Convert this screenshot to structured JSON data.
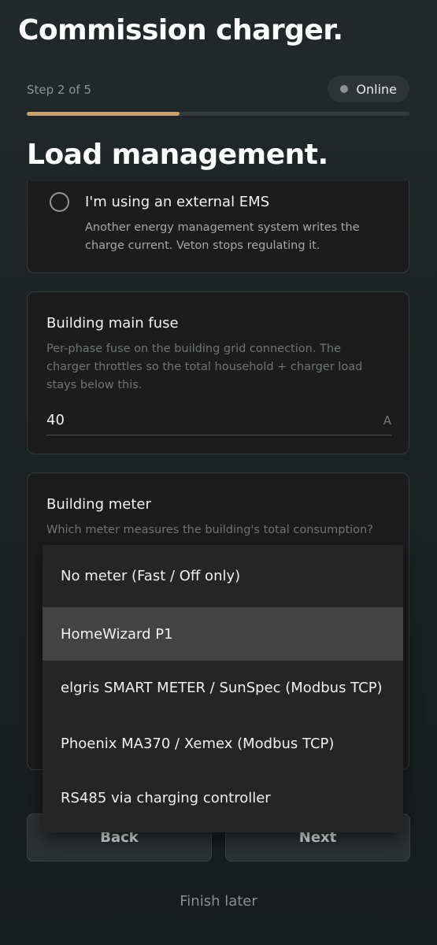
{
  "app": {
    "title": "Commission charger."
  },
  "progress": {
    "step_label": "Step 2 of 5",
    "current_step": 2,
    "total_steps": 5
  },
  "status": {
    "label": "Online",
    "dot_color": "#8c9192"
  },
  "section": {
    "title": "Load management."
  },
  "ems_option": {
    "title": "I'm using an external EMS",
    "description": "Another energy management system writes the charge current. Veton stops regulating it.",
    "checked": false
  },
  "fuse": {
    "label": "Building main fuse",
    "help": "Per-phase fuse on the building grid connection. The charger throttles so the total household + charger load stays below this.",
    "value": "40",
    "unit": "A"
  },
  "meter": {
    "label": "Building meter",
    "help": "Which meter measures the building's total consumption?",
    "selected": "HomeWizard P1",
    "options": [
      "No meter (Fast / Off only)",
      "HomeWizard P1",
      "elgris SMART METER / SunSpec (Modbus TCP)",
      "Phoenix MA370 / Xemex (Modbus TCP)",
      "RS485 via charging controller"
    ]
  },
  "actions": {
    "back": "Back",
    "next": "Next",
    "finish_later": "Finish later"
  },
  "colors": {
    "accent": "#c9a272",
    "background": "#1d2324",
    "card": "#1c1c1c"
  }
}
